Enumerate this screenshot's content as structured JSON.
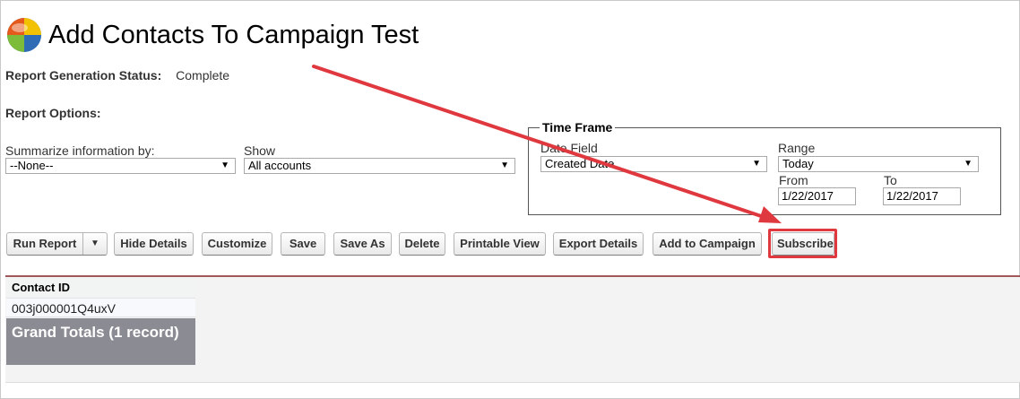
{
  "header": {
    "title": "Add Contacts To Campaign Test",
    "logo_icon": "report-logo-icon"
  },
  "status": {
    "label": "Report Generation Status:",
    "value": "Complete"
  },
  "options": {
    "label": "Report Options:",
    "summarize_label": "Summarize information by:",
    "summarize_value": "--None--",
    "show_label": "Show",
    "show_value": "All accounts"
  },
  "time_frame": {
    "legend": "Time Frame",
    "date_field_label": "Date Field",
    "date_field_value": "Created Date",
    "range_label": "Range",
    "range_value": "Today",
    "from_label": "From",
    "from_value": "1/22/2017",
    "to_label": "To",
    "to_value": "1/22/2017"
  },
  "toolbar": {
    "run_report": "Run Report",
    "hide_details": "Hide Details",
    "customize": "Customize",
    "save": "Save",
    "save_as": "Save As",
    "delete": "Delete",
    "printable_view": "Printable View",
    "export_details": "Export Details",
    "add_to_campaign": "Add to Campaign",
    "subscribe": "Subscribe"
  },
  "results": {
    "columns": [
      "Contact ID"
    ],
    "rows": [
      [
        "003j000001Q4uxV"
      ]
    ],
    "grand_totals": "Grand Totals (1 record)"
  },
  "colors": {
    "annotation_red": "#e0383f",
    "results_rule": "#a0585a",
    "totals_bg": "#8b8b93"
  }
}
